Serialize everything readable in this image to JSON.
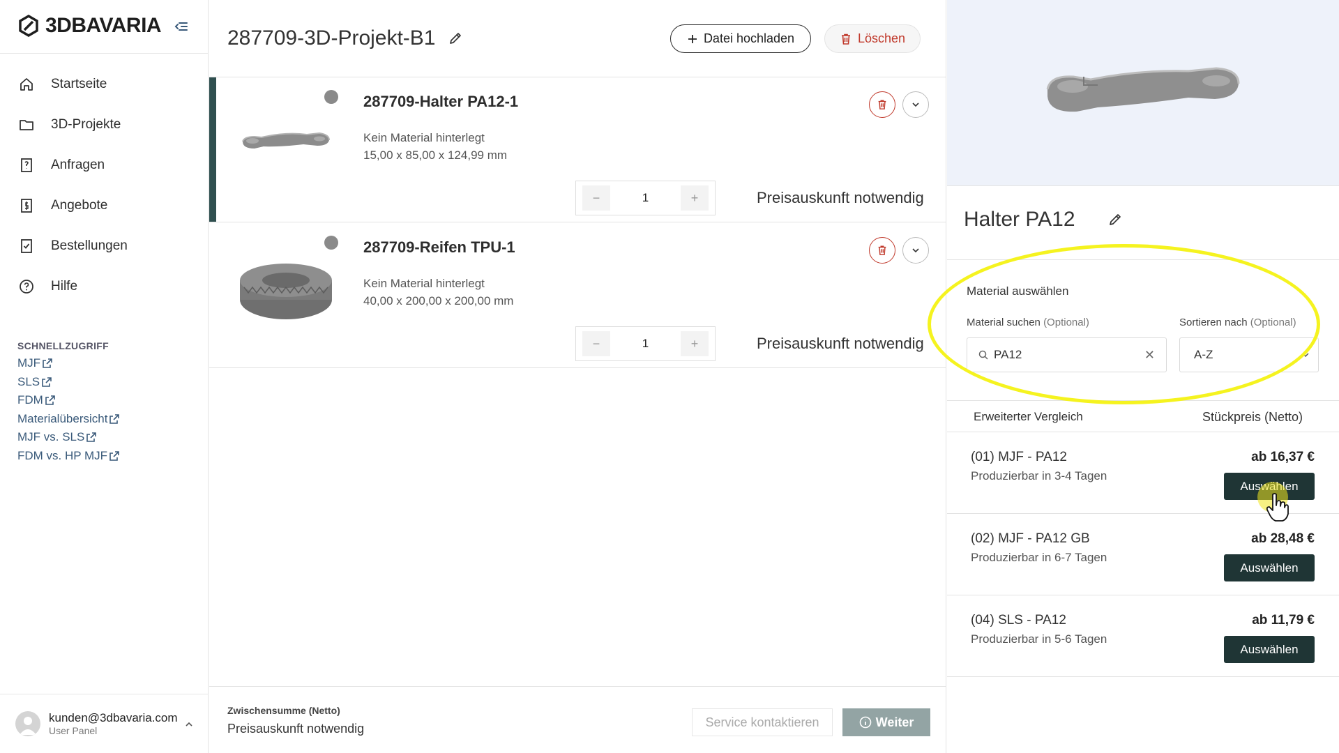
{
  "brand": {
    "name": "3DBAVARIA"
  },
  "sidebar": {
    "items": [
      {
        "label": "Startseite",
        "icon": "home-icon"
      },
      {
        "label": "3D-Projekte",
        "icon": "folder-icon"
      },
      {
        "label": "Anfragen",
        "icon": "inquiry-doc-icon"
      },
      {
        "label": "Angebote",
        "icon": "offer-doc-icon"
      },
      {
        "label": "Bestellungen",
        "icon": "order-check-icon"
      },
      {
        "label": "Hilfe",
        "icon": "help-icon"
      }
    ],
    "quick_title": "SCHNELLZUGRIFF",
    "quick_links": [
      "MJF",
      "SLS",
      "FDM",
      "Materialübersicht",
      "MJF vs. SLS",
      "FDM vs. HP MJF"
    ],
    "user": {
      "email": "kunden@3dbavaria.com",
      "role": "User Panel"
    }
  },
  "main": {
    "title": "287709-3D-Projekt-B1",
    "upload_label": "Datei hochladen",
    "delete_label": "Löschen",
    "parts": [
      {
        "name": "287709-Halter PA12-1",
        "material": "Kein Material hinterlegt",
        "dimensions": "15,00 x 85,00 x 124,99 mm",
        "quantity": "1",
        "price_note": "Preisauskunft notwendig",
        "active": true
      },
      {
        "name": "287709-Reifen TPU-1",
        "material": "Kein Material hinterlegt",
        "dimensions": "40,00 x 200,00 x 200,00 mm",
        "quantity": "1",
        "price_note": "Preisauskunft notwendig",
        "active": false
      }
    ],
    "footer": {
      "subtotal_label": "Zwischensumme (Netto)",
      "subtotal_value": "Preisauskunft notwendig",
      "service_label": "Service kontaktieren",
      "next_label": "Weiter"
    }
  },
  "detail": {
    "part_title": "Halter PA12",
    "material_section_label": "Material auswählen",
    "search_label": "Material suchen",
    "search_optional": "(Optional)",
    "search_value": "PA12",
    "sort_label": "Sortieren nach",
    "sort_optional": "(Optional)",
    "sort_value": "A-Z",
    "compare_label": "Erweiterter Vergleich",
    "unit_price_label": "Stückpreis (Netto)",
    "materials": [
      {
        "name": "(01) MJF - PA12",
        "lead_time": "Produzierbar in 3-4 Tagen",
        "price": "ab 16,37 €",
        "button": "Auswählen"
      },
      {
        "name": "(02) MJF - PA12 GB",
        "lead_time": "Produzierbar in 6-7 Tagen",
        "price": "ab 28,48 €",
        "button": "Auswählen"
      },
      {
        "name": "(04) SLS - PA12",
        "lead_time": "Produzierbar in 5-6 Tagen",
        "price": "ab 11,79 €",
        "button": "Auswählen"
      }
    ]
  },
  "colors": {
    "accent_dark": "#1f3535",
    "active_bar": "#2f4f4f",
    "danger": "#c0392b",
    "highlight": "#f5f31f",
    "preview_bg": "#eef2fa",
    "next_button_disabled": "#93a4a4"
  }
}
